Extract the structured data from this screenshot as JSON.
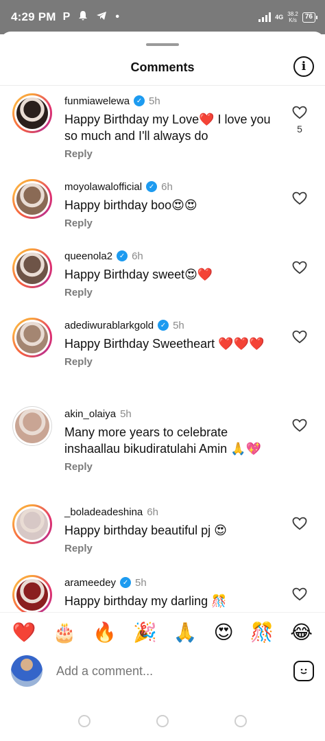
{
  "status_bar": {
    "time": "4:29 PM",
    "left_icons": [
      "p-icon",
      "bell-icon",
      "telegram-icon",
      "dot"
    ],
    "net_type": "4G",
    "speed_value": "38.2",
    "speed_unit": "K/s",
    "battery": "76"
  },
  "header": {
    "title": "Comments",
    "info_icon": "info-icon"
  },
  "comments": [
    {
      "user": "funmiawelewa",
      "verified": true,
      "time": "5h",
      "text": "Happy Birthday my Love❤️ I love you so much and I'll always do",
      "reply": "Reply",
      "likes": "5",
      "ring": true,
      "avatar_color": "#2a1f1c"
    },
    {
      "user": "moyolawalofficial",
      "verified": true,
      "time": "6h",
      "text": "Happy birthday boo😍😍",
      "reply": "Reply",
      "likes": "",
      "ring": true,
      "avatar_color": "#8a6a55"
    },
    {
      "user": "queenola2",
      "verified": true,
      "time": "6h",
      "text": "Happy Birthday sweet😍❤️",
      "reply": "Reply",
      "likes": "",
      "ring": true,
      "avatar_color": "#6e5447"
    },
    {
      "user": "adediwurablarkgold",
      "verified": true,
      "time": "5h",
      "text": "Happy Birthday Sweetheart ❤️❤️❤️",
      "reply": "Reply",
      "likes": "",
      "ring": true,
      "avatar_color": "#a48672"
    },
    {
      "user": "akin_olaiya",
      "verified": false,
      "time": "5h",
      "text": "Many more years to celebrate inshaallau bikudiratulahi Amin 🙏💖",
      "reply": "Reply",
      "likes": "",
      "ring": false,
      "avatar_color": "#c9a594"
    },
    {
      "user": "_boladeadeshina",
      "verified": false,
      "time": "6h",
      "text": "Happy birthday beautiful pj 😍",
      "reply": "Reply",
      "likes": "",
      "ring": true,
      "avatar_color": "#d7c8c6"
    },
    {
      "user": "arameedey",
      "verified": true,
      "time": "5h",
      "text": "Happy birthday my darling 🎊",
      "reply": "",
      "likes": "",
      "ring": true,
      "avatar_color": "#8a1f1f"
    }
  ],
  "emoji_bar": [
    "❤️",
    "🎂",
    "🔥",
    "🎉",
    "🙏",
    "😍",
    "🎊",
    "😂"
  ],
  "composer": {
    "placeholder": "Add a comment...",
    "sticker_icon": "sticker-icon"
  },
  "colors": {
    "ring_start": "#f9a13a",
    "ring_end": "#c13584",
    "verified": "#1d9bf0",
    "muted": "#7b7b7b"
  }
}
